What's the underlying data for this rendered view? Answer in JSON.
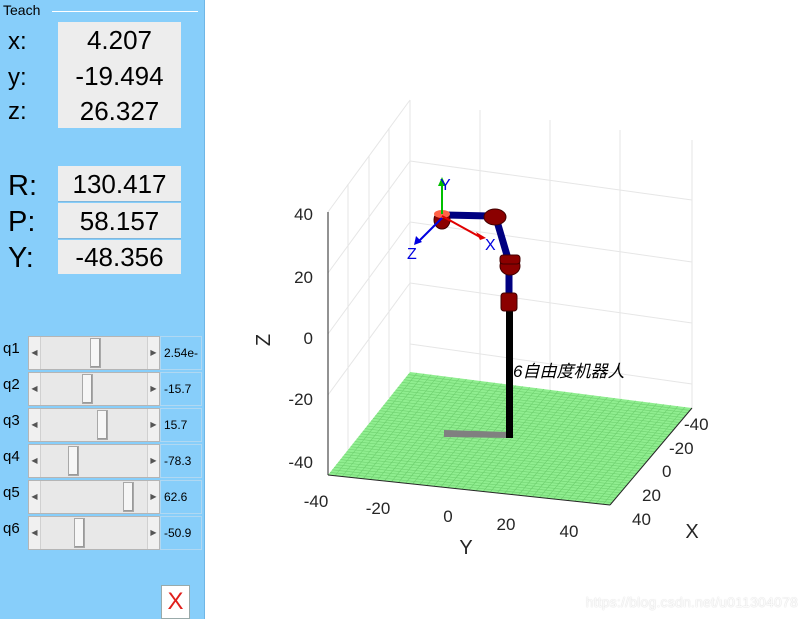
{
  "teach": {
    "title": "Teach",
    "position": [
      {
        "label": "x:",
        "value": "4.207"
      },
      {
        "label": "y:",
        "value": "-19.494"
      },
      {
        "label": "z:",
        "value": "26.327"
      }
    ],
    "orientation": [
      {
        "label": "R:",
        "value": "130.417"
      },
      {
        "label": "P:",
        "value": "58.157"
      },
      {
        "label": "Y:",
        "value": "-48.356"
      }
    ],
    "joints": [
      {
        "label": "q1",
        "value": "2.54e-",
        "level": 0.5
      },
      {
        "label": "q2",
        "value": "-15.7",
        "level": 0.42
      },
      {
        "label": "q3",
        "value": "15.7",
        "level": 0.58
      },
      {
        "label": "q4",
        "value": "-78.3",
        "level": 0.28
      },
      {
        "label": "q5",
        "value": "62.6",
        "level": 0.85
      },
      {
        "label": "q6",
        "value": "-50.9",
        "level": 0.34
      }
    ],
    "close_label": "X"
  },
  "plot": {
    "axis_x": {
      "label": "X",
      "ticks": [
        "-40",
        "-20",
        "0",
        "20",
        "40"
      ]
    },
    "axis_y": {
      "label": "Y",
      "ticks": [
        "-40",
        "-20",
        "0",
        "20",
        "40"
      ]
    },
    "axis_z": {
      "label": "Z",
      "ticks": [
        "40",
        "20",
        "0",
        "-20",
        "-40"
      ]
    },
    "robot_name": "6自由度机器人",
    "frame_labels": {
      "x": "X",
      "y": "Y",
      "z": "Z"
    },
    "colors": {
      "floor": "#90ee90",
      "link": "#000080",
      "joint": "#8b0000",
      "frame_x": "#e00000",
      "frame_y": "#00c000",
      "frame_z": "#0000e0"
    }
  },
  "watermark": "https://blog.csdn.net/u011304078"
}
